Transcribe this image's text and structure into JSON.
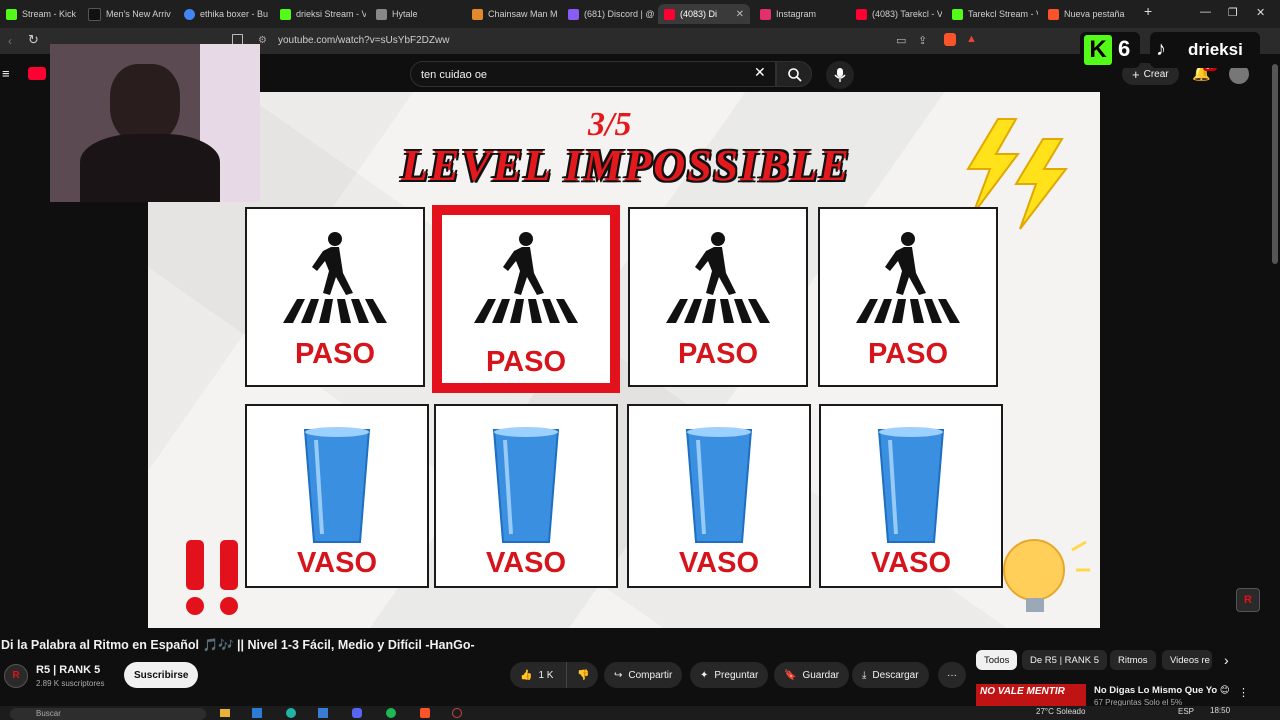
{
  "browser": {
    "tabs": [
      {
        "label": "Stream - Kick Da",
        "color": "#53fc18"
      },
      {
        "label": "Men's New Arriv",
        "color": "#111111"
      },
      {
        "label": "ethika boxer - Bu",
        "color": "#4285f4"
      },
      {
        "label": "drieksi Stream - V",
        "color": "#53fc18"
      },
      {
        "label": "Hytale",
        "color": "#888888"
      },
      {
        "label": "Chainsaw Man M",
        "color": "#e28a2b"
      },
      {
        "label": "(681) Discord | @",
        "color": "#8a5cf6"
      },
      {
        "label": "(4083) Di",
        "color": "#ff0033"
      },
      {
        "label": "Instagram",
        "color": "#e1306c"
      },
      {
        "label": "(4083) Tarekcl - V",
        "color": "#ff0033"
      },
      {
        "label": "Tarekcl Stream - V",
        "color": "#53fc18"
      },
      {
        "label": "Nueva pestaña",
        "color": "#fb542b"
      }
    ],
    "new_tab": "+",
    "url": "youtube.com/watch?v=sUsYbF2DZww"
  },
  "youtube": {
    "search_value": "ten cuidao oe",
    "crear": "Crear",
    "notif_badge": "9+"
  },
  "overlay": {
    "kick_count": "6",
    "tiktok_name": "drieksi"
  },
  "video": {
    "level_num": "3/5",
    "level_title": "LEVEL IMPOSSIBLE",
    "row1": [
      "PASO",
      "PASO",
      "PASO",
      "PASO"
    ],
    "row2": [
      "VASO",
      "VASO",
      "VASO",
      "VASO"
    ],
    "channel_watermark": "R"
  },
  "below": {
    "title": "Di la Palabra al Ritmo en Español 🎵🎶 || Nivel 1-3 Fácil, Medio y Difícil -HanGo-",
    "channel_name": "R5 | RANK 5",
    "subs": "2.89 K suscriptores",
    "subscribe": "Suscribirse",
    "likes": "1 K",
    "share": "Compartir",
    "ask": "Preguntar",
    "save": "Guardar",
    "download": "Descargar",
    "more": "···"
  },
  "chips": [
    "Todos",
    "De R5 | RANK 5",
    "Ritmos",
    "Videos re"
  ],
  "rec": {
    "thumb_text": "NO VALE MENTIR",
    "title": "No Digas Lo Mismo Que Yo 😊",
    "sub": "67 Preguntas Solo el 5%"
  },
  "taskbar": {
    "search_placeholder": "Buscar",
    "weather": "27°C  Soleado",
    "lang": "ESP",
    "time": "18:50"
  }
}
